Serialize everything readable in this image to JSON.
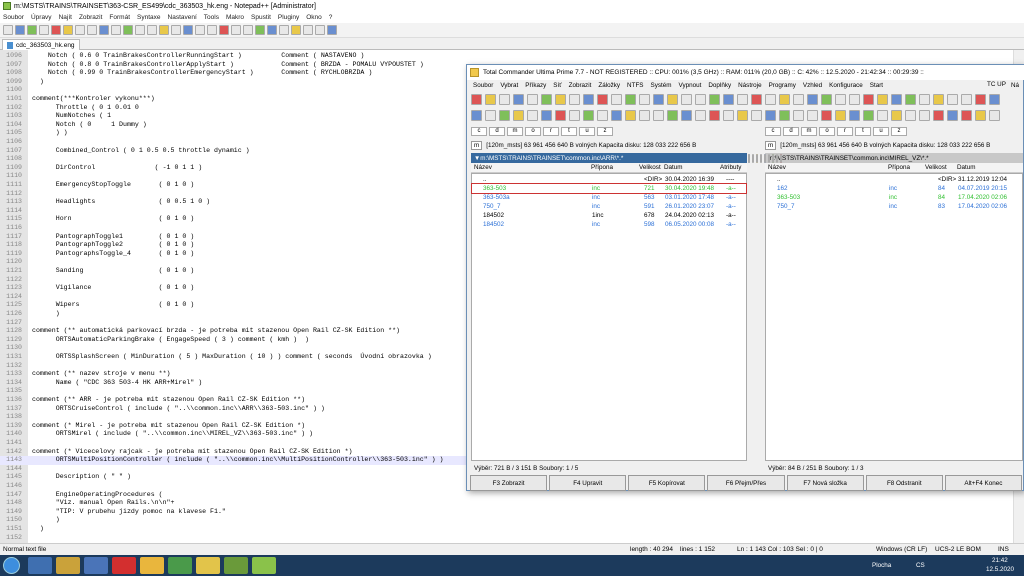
{
  "npp": {
    "title": "m:\\MSTS\\TRAINS\\TRAINSET\\363-CSR_ES499\\cdc_363503_hk.eng - Notepad++ [Administrator]",
    "menu": [
      "Soubor",
      "Úpravy",
      "Najít",
      "Zobrazit",
      "Formát",
      "Syntaxe",
      "Nastavení",
      "Tools",
      "Makro",
      "Spustit",
      "Pluginy",
      "Okno",
      "?"
    ],
    "tab": "cdc_363503_hk.eng",
    "lines": [
      {
        "n": "1096",
        "t": "    Notch ( 0.6 0 TrainBrakesControllerRunningStart )          Comment ( NASTAVENO )"
      },
      {
        "n": "1097",
        "t": "    Notch ( 0.8 0 TrainBrakesControllerApplyStart )            Comment ( BRZDA - POMALU VYPOUSTET )"
      },
      {
        "n": "1098",
        "t": "    Notch ( 0.99 0 TrainBrakesControllerEmergencyStart )       Comment ( RYCHLOBRZDA )"
      },
      {
        "n": "1099",
        "t": "  )"
      },
      {
        "n": "1100",
        "t": ""
      },
      {
        "n": "1101",
        "t": "comment(***Kontroler vykonu***)"
      },
      {
        "n": "1102",
        "t": "      Throttle ( 0 1 0.01 0"
      },
      {
        "n": "1103",
        "t": "      NumNotches ( 1"
      },
      {
        "n": "1104",
        "t": "      Notch ( 0     1 Dummy )"
      },
      {
        "n": "1105",
        "t": "      ) )"
      },
      {
        "n": "1106",
        "t": ""
      },
      {
        "n": "1107",
        "t": "      Combined_Control ( 0 1 0.5 0.5 throttle dynamic )"
      },
      {
        "n": "1108",
        "t": ""
      },
      {
        "n": "1109",
        "t": "      DirControl               ( -1 0 1 1 )"
      },
      {
        "n": "1110",
        "t": ""
      },
      {
        "n": "1111",
        "t": "      EmergencyStopToggle       ( 0 1 0 )"
      },
      {
        "n": "1112",
        "t": ""
      },
      {
        "n": "1113",
        "t": "      Headlights                ( 0 0.5 1 0 )"
      },
      {
        "n": "1114",
        "t": ""
      },
      {
        "n": "1115",
        "t": "      Horn                      ( 0 1 0 )"
      },
      {
        "n": "1116",
        "t": ""
      },
      {
        "n": "1117",
        "t": "      PantographToggle1         ( 0 1 0 )"
      },
      {
        "n": "1118",
        "t": "      PantographToggle2         ( 0 1 0 )"
      },
      {
        "n": "1119",
        "t": "      PantographsToggle_4       ( 0 1 0 )"
      },
      {
        "n": "1120",
        "t": ""
      },
      {
        "n": "1121",
        "t": "      Sanding                   ( 0 1 0 )"
      },
      {
        "n": "1122",
        "t": ""
      },
      {
        "n": "1123",
        "t": "      Vigilance                 ( 0 1 0 )"
      },
      {
        "n": "1124",
        "t": ""
      },
      {
        "n": "1125",
        "t": "      Wipers                    ( 0 1 0 )"
      },
      {
        "n": "1126",
        "t": "      )"
      },
      {
        "n": "1127",
        "t": ""
      },
      {
        "n": "1128",
        "t": "comment (** automatická parkovací brzda - je potreba mit stazenou Open Rail CZ-SK Edition **)"
      },
      {
        "n": "1129",
        "t": "      ORTSAutomaticParkingBrake ( EngageSpeed ( 3 ) comment ( kmh )  )"
      },
      {
        "n": "1130",
        "t": ""
      },
      {
        "n": "1131",
        "t": "      ORTSSplashScreen ( MinDuration ( 5 ) MaxDuration ( 10 ) ) comment ( seconds  Úvodní obrazovka )"
      },
      {
        "n": "1132",
        "t": ""
      },
      {
        "n": "1133",
        "t": "comment (** nazev stroje v menu **)"
      },
      {
        "n": "1134",
        "t": "      Name ( \"CDC 363 503-4 HK ARR+Mirel\" )"
      },
      {
        "n": "1135",
        "t": ""
      },
      {
        "n": "1136",
        "t": "comment (** ARR - je potreba mit stazenou Open Rail CZ-SK Edition **)"
      },
      {
        "n": "1137",
        "t": "      ORTSCruiseControl ( include ( \"..\\\\common.inc\\\\ARR\\\\363-503.inc\" ) )"
      },
      {
        "n": "1138",
        "t": ""
      },
      {
        "n": "1139",
        "t": "comment (* Mirel - je potreba mit stazenou Open Rail CZ-SK Edition *)"
      },
      {
        "n": "1140",
        "t": "      ORTSMirel ( include ( \"..\\\\common.inc\\\\MIREL_VZ\\\\363-503.inc\" ) )"
      },
      {
        "n": "1141",
        "t": ""
      },
      {
        "n": "1142",
        "t": "comment (* Vicecelovy rajcak - je potreba mit stazenou Open Rail CZ-SK Edition *)"
      },
      {
        "n": "1143",
        "t": "      ORTSMultiPositionController ( include ( \"..\\\\common.inc\\\\MultiPositionController\\\\363-503.inc\" ) )",
        "hl": true
      },
      {
        "n": "1144",
        "t": ""
      },
      {
        "n": "1145",
        "t": "      Description ( \" \" )"
      },
      {
        "n": "1146",
        "t": ""
      },
      {
        "n": "1147",
        "t": "      EngineOperatingProcedures ("
      },
      {
        "n": "1148",
        "t": "      \"Viz. manual Open Rails.\\n\\n\"+"
      },
      {
        "n": "1149",
        "t": "      \"TIP: V prubehu jizdy pomoc na klavese F1.\""
      },
      {
        "n": "1150",
        "t": "      )"
      },
      {
        "n": "1151",
        "t": "  )"
      },
      {
        "n": "1152",
        "t": ""
      }
    ],
    "status": {
      "type": "Normal text file",
      "length": "length : 40 294",
      "lines": "lines : 1 152",
      "pos": "Ln : 1 143   Col : 103   Sel : 0 | 0",
      "eol": "Windows (CR LF)",
      "enc": "UCS-2 LE BOM",
      "ins": "INS"
    }
  },
  "tc": {
    "title": "Total Commander Ultima Prime 7.7 - NOT REGISTERED :: CPU: 001% (3,5 GHz) :: RAM: 011% (20,0 GB) :: C: 42% :: 12.5.2020 - 21:42:34 :: 00:29:39 ::",
    "menu": [
      "Soubor",
      "Vybrat",
      "Příkazy",
      "Síť",
      "Zobrazit",
      "Záložky",
      "NTFS",
      "Systém",
      "Vypnout",
      "Doplňky",
      "Nástroje",
      "Programy",
      "Vzhled",
      "Konfigurace",
      "Start"
    ],
    "tcup": "TC UP",
    "ribbon_right": "Ná",
    "left": {
      "drive": "m",
      "info": "[120m_msts]  63 961 456 640 B volných  Kapacita disku: 128 033 222 656 B",
      "path": "▼m:\\MSTS\\TRAINS\\TRAINSET\\common.inc\\ARR\\*.*",
      "cols": [
        "Název",
        "Přípona",
        "Velikost",
        "Datum",
        "Atributy"
      ],
      "rows": [
        {
          "name": "..",
          "ext": "",
          "size": "<DIR>",
          "date": "30.04.2020 16:39",
          "attr": "----",
          "c": "#000"
        },
        {
          "name": "363-503",
          "ext": "inc",
          "size": "721",
          "date": "30.04.2020 19:48",
          "attr": "-a--",
          "c": "#2fbf2f",
          "sel": true
        },
        {
          "name": "363-503a",
          "ext": "inc",
          "size": "563",
          "date": "03.01.2020 17:48",
          "attr": "-a--",
          "c": "#2a6fd6"
        },
        {
          "name": "750_7",
          "ext": "inc",
          "size": "591",
          "date": "26.01.2020 23:07",
          "attr": "-a--",
          "c": "#2a6fd6"
        },
        {
          "name": "184502",
          "ext": "1inc",
          "size": "678",
          "date": "24.04.2020 02:13",
          "attr": "-a--",
          "c": "#000"
        },
        {
          "name": "184502",
          "ext": "inc",
          "size": "598",
          "date": "06.05.2020 00:08",
          "attr": "-a--",
          "c": "#2a6fd6"
        }
      ],
      "footer": "Výběr: 721 B / 3 151 B   Soubory: 1 / 5"
    },
    "right": {
      "drive": "m",
      "info": "[120m_msts]  63 961 456 640 B volných  Kapacita disku: 128 033 222 656 B",
      "path": "m:\\MSTS\\TRAINS\\TRAINSET\\common.inc\\MIREL_VZ\\*.*",
      "cols": [
        "Název",
        "Přípona",
        "Velikost",
        "Datum"
      ],
      "rows": [
        {
          "name": "..",
          "ext": "",
          "size": "<DIR>",
          "date": "31.12.2019 12:04",
          "c": "#000"
        },
        {
          "name": "162",
          "ext": "inc",
          "size": "84",
          "date": "04.07.2019 20:15",
          "c": "#2a6fd6"
        },
        {
          "name": "363-503",
          "ext": "inc",
          "size": "84",
          "date": "17.04.2020 02:06",
          "c": "#2fbf2f"
        },
        {
          "name": "750_7",
          "ext": "inc",
          "size": "83",
          "date": "17.04.2020 02:06",
          "c": "#2a6fd6"
        }
      ],
      "footer": "Výběr: 84 B / 251 B   Soubory: 1 / 3"
    },
    "fkeys": [
      "F3 Zobrazit",
      "F4 Upravit",
      "F5 Kopírovat",
      "F6 Přejm/Přes",
      "F7 Nová složka",
      "F8 Odstranit",
      "Alt+F4 Konec"
    ]
  },
  "taskbar": {
    "desktop": "Plocha",
    "lang": "CS",
    "time": "21:42",
    "date": "12.5.2020"
  }
}
